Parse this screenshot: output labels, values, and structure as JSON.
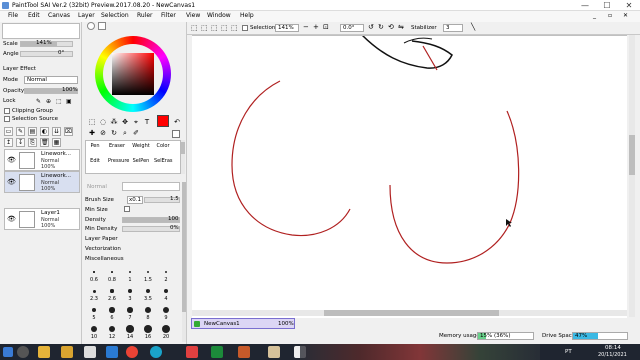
{
  "window": {
    "title": "PaintTool SAI Ver.2 (32bit) Preview.2017.08.20 - NewCanvas1"
  },
  "menu": [
    "File",
    "Edit",
    "Canvas",
    "Layer",
    "Selection",
    "Ruler",
    "Filter",
    "View",
    "Window",
    "Help"
  ],
  "left": {
    "scale_label": "Scale",
    "scale_value": "141%",
    "angle_label": "Angle",
    "angle_value": "0°",
    "layer_effect": "Layer Effect",
    "mode_label": "Mode",
    "mode_value": "Normal",
    "opacity_label": "Opacity",
    "opacity_value": "100%",
    "opacity_fraction": 1.0,
    "lock_label": "Lock",
    "clipping_group": "Clipping Group",
    "selection_source": "Selection Source",
    "layers": [
      {
        "name": "Linework...",
        "mode": "Normal",
        "opacity": "100%"
      },
      {
        "name": "Linework...",
        "mode": "Normal",
        "opacity": "100%"
      },
      {
        "name": "Layer1",
        "mode": "Normal",
        "opacity": "100%"
      }
    ]
  },
  "tools": {
    "brush_groups": [
      "Pen",
      "Eraser",
      "Weight",
      "Color",
      "Edit",
      "Pressure",
      "SelPen",
      "SelEras"
    ],
    "shape_label": "Normal",
    "brush_size_label": "Brush Size",
    "brush_size_mult": "x0.1",
    "brush_size_value": "1.5",
    "min_size_label": "Min Size",
    "density_label": "Density",
    "density_value": "100",
    "density_fraction": 1.0,
    "min_density_label": "Min Density",
    "min_density_value": "0%",
    "min_density_fraction": 0,
    "layer_paper": "Layer Paper",
    "vectorization": "Vectorization",
    "miscellaneous": "Miscellaneous",
    "size_presets": [
      "0.6",
      "0.8",
      "1",
      "1.5",
      "2",
      "2.3",
      "2.6",
      "3",
      "3.5",
      "4",
      "5",
      "6",
      "7",
      "8",
      "9",
      "10",
      "12",
      "14",
      "16",
      "20"
    ],
    "primary_color": "#ff0000"
  },
  "canvas_toolbar": {
    "selection_label": "Selection",
    "zoom_value": "141%",
    "stabilizer_label": "Stabilizer",
    "stabilizer_value": "3",
    "angle_value": "0.0°"
  },
  "status": {
    "canvas_tab": "NewCanvas1",
    "canvas_tab_zoom": "100%",
    "memory_label": "Memory usage",
    "memory_value": "15% (36%)",
    "memory_fraction": 0.15,
    "drive_label": "Drive Space",
    "drive_value": "47%",
    "drive_fraction": 0.47
  },
  "taskbar": {
    "time": "08:14",
    "date": "20/11/2021",
    "lang": "PT"
  },
  "colors": {
    "accent_blue": "#0078d7",
    "ink_red": "#b02020",
    "panel_bg": "#f0f0f0",
    "layer_selected": "#d8dff0"
  }
}
